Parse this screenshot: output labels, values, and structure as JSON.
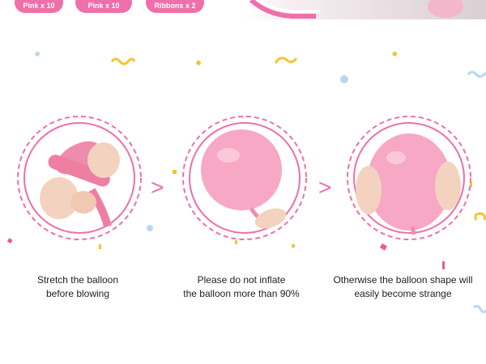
{
  "top_strip": {
    "pills": [
      "Pink x 10",
      "Pink x 10",
      "Ribbons x 2"
    ]
  },
  "steps": [
    {
      "lines": [
        "Stretch the balloon",
        "before blowing"
      ]
    },
    {
      "lines": [
        "Please do not inflate",
        "the balloon more than 90%"
      ]
    },
    {
      "lines": [
        "Otherwise the balloon shape will",
        "easily become strange"
      ]
    }
  ],
  "arrow_glyph": ">",
  "colors": {
    "accent": "#ee6fa9",
    "balloon": "#f7a8c4",
    "dashed_ring": "#ee6fa9",
    "confetti_yellow": "#f3c530",
    "confetti_blue": "#b9d6f4",
    "confetti_pink": "#ee5a8f"
  }
}
